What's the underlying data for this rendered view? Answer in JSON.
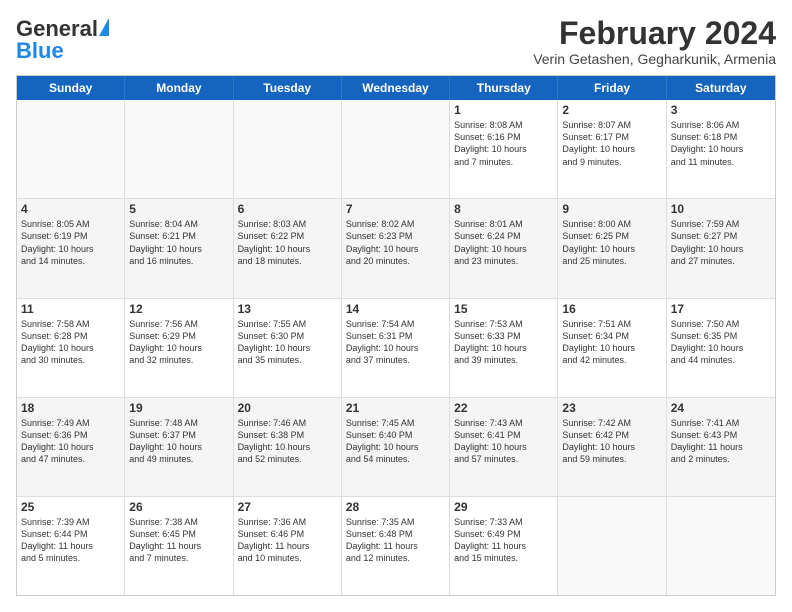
{
  "header": {
    "logo_general": "General",
    "logo_blue": "Blue",
    "month_title": "February 2024",
    "location": "Verin Getashen, Gegharkunik, Armenia"
  },
  "weekdays": [
    "Sunday",
    "Monday",
    "Tuesday",
    "Wednesday",
    "Thursday",
    "Friday",
    "Saturday"
  ],
  "rows": [
    [
      {
        "day": "",
        "info": ""
      },
      {
        "day": "",
        "info": ""
      },
      {
        "day": "",
        "info": ""
      },
      {
        "day": "",
        "info": ""
      },
      {
        "day": "1",
        "info": "Sunrise: 8:08 AM\nSunset: 6:16 PM\nDaylight: 10 hours\nand 7 minutes."
      },
      {
        "day": "2",
        "info": "Sunrise: 8:07 AM\nSunset: 6:17 PM\nDaylight: 10 hours\nand 9 minutes."
      },
      {
        "day": "3",
        "info": "Sunrise: 8:06 AM\nSunset: 6:18 PM\nDaylight: 10 hours\nand 11 minutes."
      }
    ],
    [
      {
        "day": "4",
        "info": "Sunrise: 8:05 AM\nSunset: 6:19 PM\nDaylight: 10 hours\nand 14 minutes."
      },
      {
        "day": "5",
        "info": "Sunrise: 8:04 AM\nSunset: 6:21 PM\nDaylight: 10 hours\nand 16 minutes."
      },
      {
        "day": "6",
        "info": "Sunrise: 8:03 AM\nSunset: 6:22 PM\nDaylight: 10 hours\nand 18 minutes."
      },
      {
        "day": "7",
        "info": "Sunrise: 8:02 AM\nSunset: 6:23 PM\nDaylight: 10 hours\nand 20 minutes."
      },
      {
        "day": "8",
        "info": "Sunrise: 8:01 AM\nSunset: 6:24 PM\nDaylight: 10 hours\nand 23 minutes."
      },
      {
        "day": "9",
        "info": "Sunrise: 8:00 AM\nSunset: 6:25 PM\nDaylight: 10 hours\nand 25 minutes."
      },
      {
        "day": "10",
        "info": "Sunrise: 7:59 AM\nSunset: 6:27 PM\nDaylight: 10 hours\nand 27 minutes."
      }
    ],
    [
      {
        "day": "11",
        "info": "Sunrise: 7:58 AM\nSunset: 6:28 PM\nDaylight: 10 hours\nand 30 minutes."
      },
      {
        "day": "12",
        "info": "Sunrise: 7:56 AM\nSunset: 6:29 PM\nDaylight: 10 hours\nand 32 minutes."
      },
      {
        "day": "13",
        "info": "Sunrise: 7:55 AM\nSunset: 6:30 PM\nDaylight: 10 hours\nand 35 minutes."
      },
      {
        "day": "14",
        "info": "Sunrise: 7:54 AM\nSunset: 6:31 PM\nDaylight: 10 hours\nand 37 minutes."
      },
      {
        "day": "15",
        "info": "Sunrise: 7:53 AM\nSunset: 6:33 PM\nDaylight: 10 hours\nand 39 minutes."
      },
      {
        "day": "16",
        "info": "Sunrise: 7:51 AM\nSunset: 6:34 PM\nDaylight: 10 hours\nand 42 minutes."
      },
      {
        "day": "17",
        "info": "Sunrise: 7:50 AM\nSunset: 6:35 PM\nDaylight: 10 hours\nand 44 minutes."
      }
    ],
    [
      {
        "day": "18",
        "info": "Sunrise: 7:49 AM\nSunset: 6:36 PM\nDaylight: 10 hours\nand 47 minutes."
      },
      {
        "day": "19",
        "info": "Sunrise: 7:48 AM\nSunset: 6:37 PM\nDaylight: 10 hours\nand 49 minutes."
      },
      {
        "day": "20",
        "info": "Sunrise: 7:46 AM\nSunset: 6:38 PM\nDaylight: 10 hours\nand 52 minutes."
      },
      {
        "day": "21",
        "info": "Sunrise: 7:45 AM\nSunset: 6:40 PM\nDaylight: 10 hours\nand 54 minutes."
      },
      {
        "day": "22",
        "info": "Sunrise: 7:43 AM\nSunset: 6:41 PM\nDaylight: 10 hours\nand 57 minutes."
      },
      {
        "day": "23",
        "info": "Sunrise: 7:42 AM\nSunset: 6:42 PM\nDaylight: 10 hours\nand 59 minutes."
      },
      {
        "day": "24",
        "info": "Sunrise: 7:41 AM\nSunset: 6:43 PM\nDaylight: 11 hours\nand 2 minutes."
      }
    ],
    [
      {
        "day": "25",
        "info": "Sunrise: 7:39 AM\nSunset: 6:44 PM\nDaylight: 11 hours\nand 5 minutes."
      },
      {
        "day": "26",
        "info": "Sunrise: 7:38 AM\nSunset: 6:45 PM\nDaylight: 11 hours\nand 7 minutes."
      },
      {
        "day": "27",
        "info": "Sunrise: 7:36 AM\nSunset: 6:46 PM\nDaylight: 11 hours\nand 10 minutes."
      },
      {
        "day": "28",
        "info": "Sunrise: 7:35 AM\nSunset: 6:48 PM\nDaylight: 11 hours\nand 12 minutes."
      },
      {
        "day": "29",
        "info": "Sunrise: 7:33 AM\nSunset: 6:49 PM\nDaylight: 11 hours\nand 15 minutes."
      },
      {
        "day": "",
        "info": ""
      },
      {
        "day": "",
        "info": ""
      }
    ]
  ]
}
